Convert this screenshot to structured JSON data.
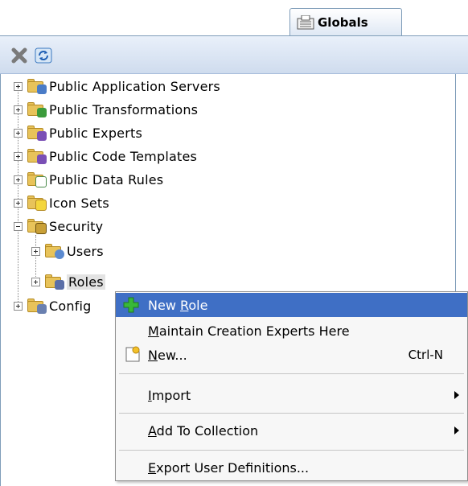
{
  "tab": {
    "label": "Globals"
  },
  "toolbar": {
    "buttons": [
      "close-icon",
      "refresh-icon"
    ]
  },
  "tree": {
    "items": [
      {
        "label": "Public Application Servers"
      },
      {
        "label": "Public Transformations"
      },
      {
        "label": "Public Experts"
      },
      {
        "label": "Public Code Templates"
      },
      {
        "label": "Public Data Rules"
      },
      {
        "label": "Icon Sets"
      },
      {
        "label": "Security"
      },
      {
        "label": "Users"
      },
      {
        "label": "Roles"
      },
      {
        "label": "Config"
      }
    ]
  },
  "menu": {
    "items": [
      {
        "label": "New Role",
        "pre": "New ",
        "mnemonic": "R",
        "post": "ole"
      },
      {
        "label": "Maintain Creation Experts Here",
        "pre": "",
        "mnemonic": "M",
        "post": "aintain Creation Experts Here"
      },
      {
        "label": "New...",
        "pre": "",
        "mnemonic": "N",
        "post": "ew...",
        "accel": "Ctrl-N"
      },
      {
        "label": "Import",
        "pre": "",
        "mnemonic": "I",
        "post": "mport"
      },
      {
        "label": "Add To Collection",
        "pre": "",
        "mnemonic": "A",
        "post": "dd To Collection"
      },
      {
        "label": "Export User Definitions...",
        "pre": "",
        "mnemonic": "E",
        "post": "xport User Definitions..."
      }
    ]
  },
  "colors": {
    "menu_highlight": "#3f6fc5",
    "toolbar": "#cfdcee",
    "folder": "#e8c35a"
  }
}
